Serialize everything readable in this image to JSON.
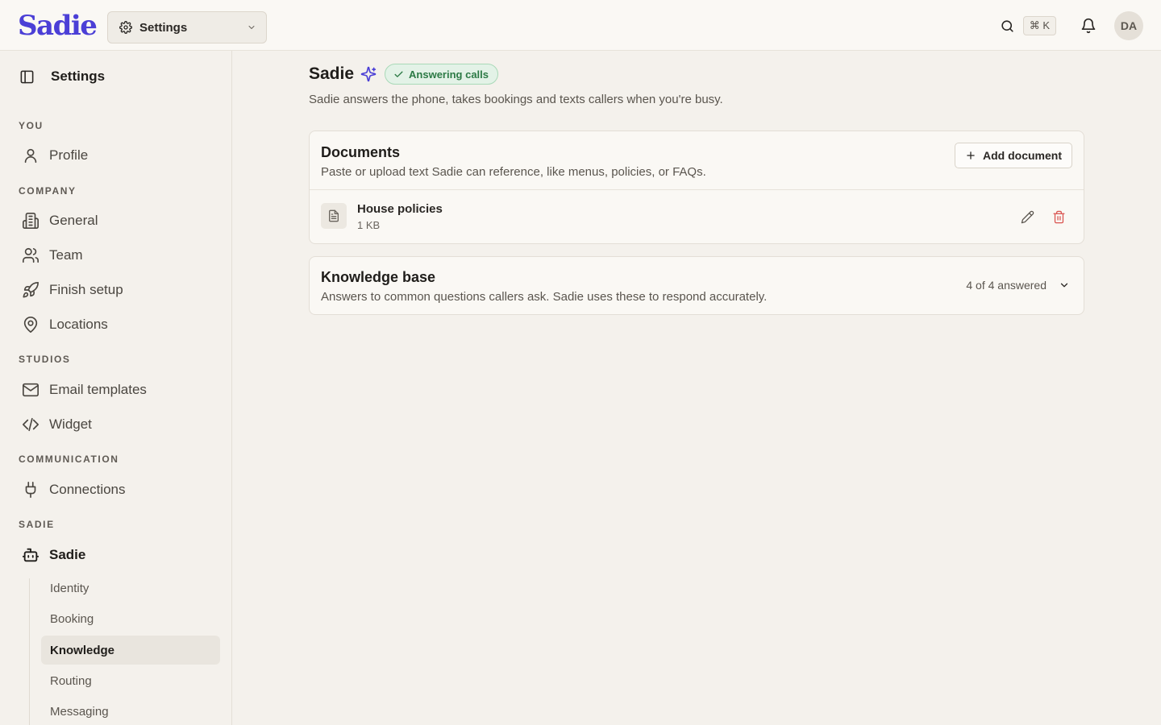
{
  "brand": {
    "name": "Sadie",
    "color": "#4b3fd6"
  },
  "topbar": {
    "workspace_select": "Settings",
    "shortcut_hint": "⌘ K",
    "avatar_initials": "DA"
  },
  "sidebar": {
    "title": "Settings",
    "sections": {
      "you": "YOU",
      "company": "COMPANY",
      "studios": "STUDIOS",
      "communication": "COMMUNICATION",
      "sadie": "SADIE"
    },
    "items": {
      "profile": "Profile",
      "general": "General",
      "team": "Team",
      "finish_setup": "Finish setup",
      "locations": "Locations",
      "email_templates": "Email templates",
      "widget": "Widget",
      "connections": "Connections",
      "sadie": "Sadie"
    },
    "sadie_subitems": [
      "Identity",
      "Booking",
      "Knowledge",
      "Routing",
      "Messaging"
    ],
    "active_subitem": "Knowledge"
  },
  "page": {
    "title": "Sadie",
    "status_badge": "Answering calls",
    "status_color": "#2c7a45",
    "subtitle": "Sadie answers the phone, takes bookings and texts callers when you're busy."
  },
  "documents": {
    "title": "Documents",
    "description": "Paste or upload text Sadie can reference, like menus, policies, or FAQs.",
    "add_button": "Add document",
    "items": [
      {
        "name": "House policies",
        "size": "1 KB"
      }
    ]
  },
  "knowledge_base": {
    "title": "Knowledge base",
    "description": "Answers to common questions callers ask. Sadie uses these to respond accurately.",
    "count": "4 of 4 answered"
  },
  "icons": {
    "search": "search-icon",
    "bell": "bell-icon",
    "gear": "gear-icon",
    "sidebar_toggle": "sidebar-toggle-icon",
    "delete_color": "#d9534f"
  }
}
